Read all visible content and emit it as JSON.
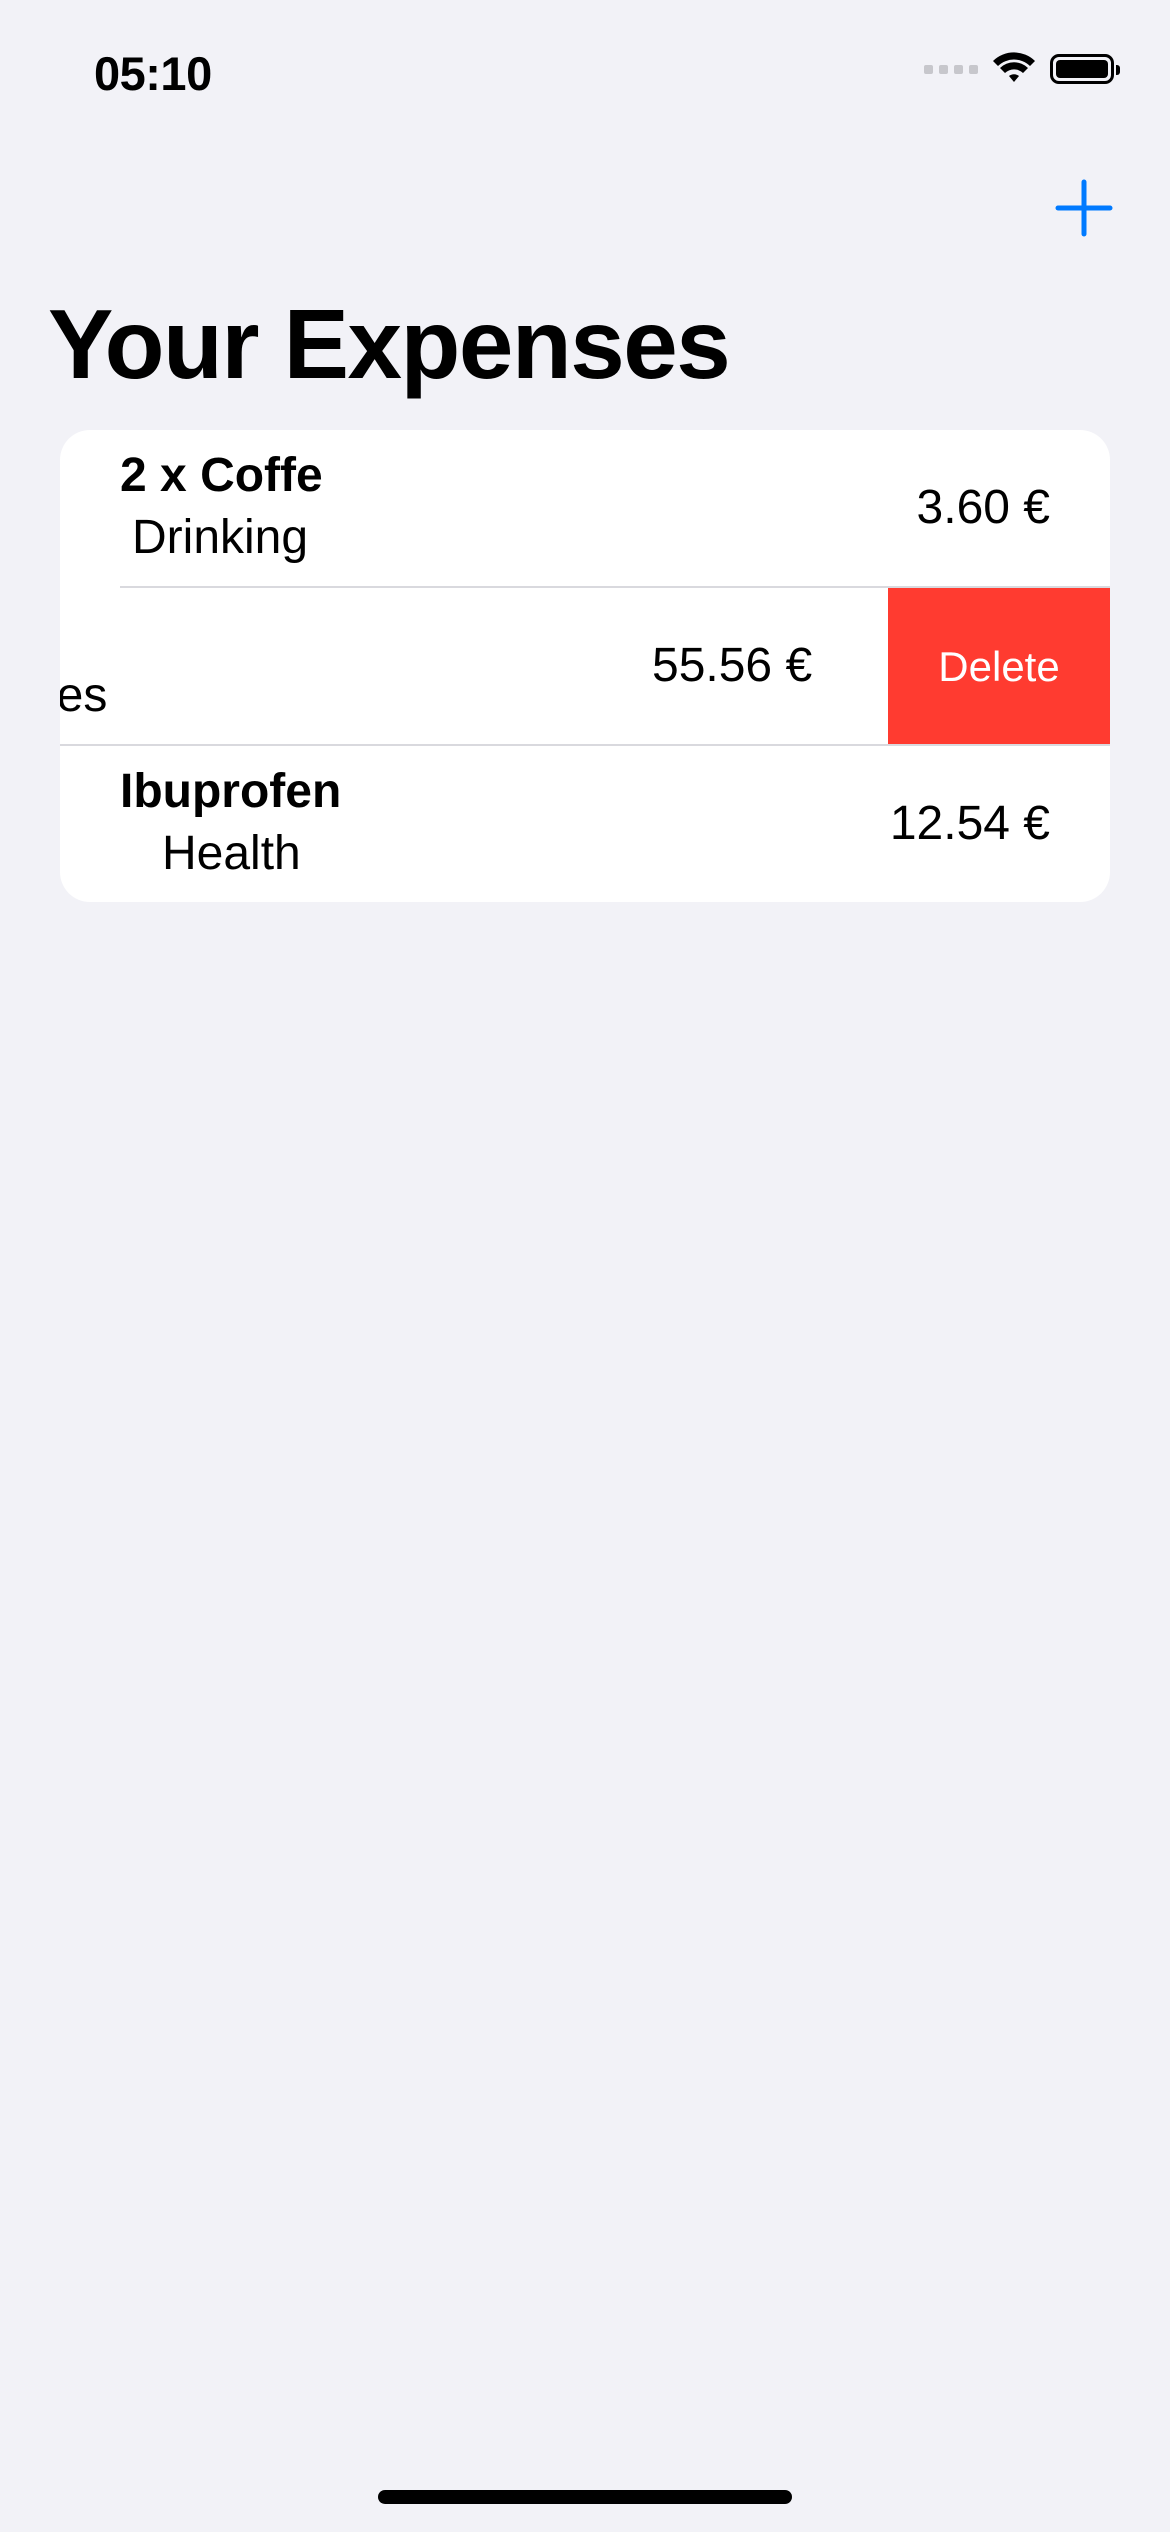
{
  "status_bar": {
    "time": "05:10"
  },
  "nav": {
    "add_icon": "plus-icon",
    "accent_color": "#007AFF"
  },
  "title": "Your Expenses",
  "expenses": [
    {
      "name": "2 x Coffe",
      "category": "Drinking",
      "amount": "3.60 €"
    },
    {
      "name": "",
      "category": "ies",
      "amount": "55.56 €",
      "action": "Delete"
    },
    {
      "name": "Ibuprofen",
      "category": "Health",
      "amount": "12.54 €"
    }
  ],
  "colors": {
    "background": "#F2F2F7",
    "delete": "#FF3B30"
  }
}
